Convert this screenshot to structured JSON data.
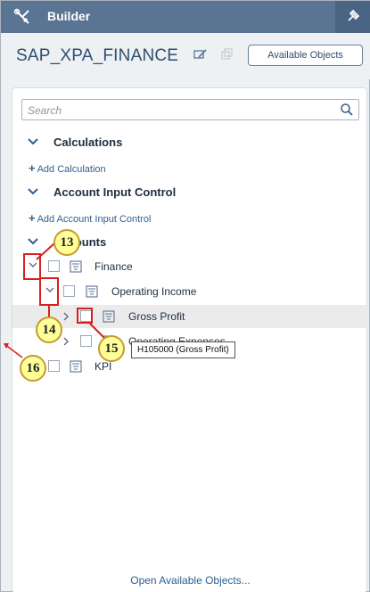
{
  "topbar": {
    "title": "Builder",
    "tool_icon": "wrench-screwdriver-icon",
    "pin_icon": "pin-icon"
  },
  "header": {
    "model_name": "SAP_XPA_FINANCE",
    "available_objects_label": "Available Objects"
  },
  "search": {
    "placeholder": "Search"
  },
  "sections": {
    "calculations": {
      "label": "Calculations",
      "add_label": "Add Calculation"
    },
    "account_input_control": {
      "label": "Account Input Control",
      "add_label": "Add Account Input Control"
    },
    "accounts": {
      "label": "Accounts"
    }
  },
  "tree": {
    "finance": "Finance",
    "operating_income": "Operating Income",
    "gross_profit": "Gross Profit",
    "operating_expenses": "Operating Expenses",
    "kpi": "KPI"
  },
  "tooltip": {
    "text": "H105000 (Gross Profit)"
  },
  "footer": {
    "open_available_objects": "Open Available Objects..."
  },
  "callouts": [
    "13",
    "14",
    "15",
    "16"
  ],
  "colors": {
    "topbar": "#5a7493",
    "link": "#2f5f8f",
    "callout_fill": "#ffff99",
    "highlight_box": "#d82020"
  }
}
